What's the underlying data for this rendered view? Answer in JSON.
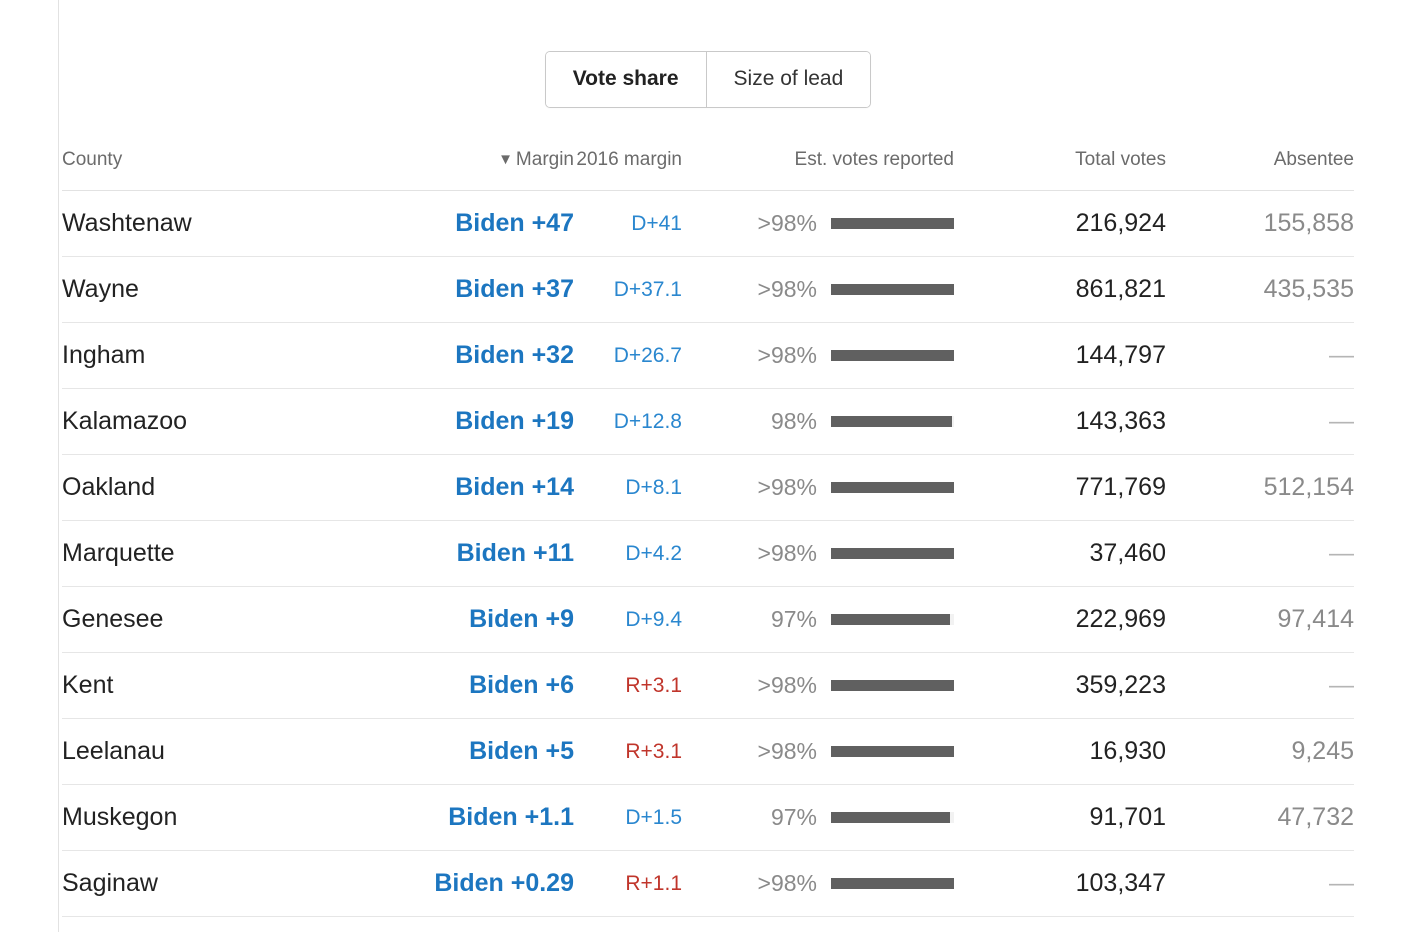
{
  "toggle": {
    "options": [
      {
        "label": "Vote share",
        "active": true
      },
      {
        "label": "Size of lead",
        "active": false
      }
    ]
  },
  "table": {
    "columns": {
      "county": "County",
      "margin": "Margin",
      "margin_sort_icon": "▼",
      "margin_2016": "2016 margin",
      "reported": "Est. votes reported",
      "total_votes": "Total votes",
      "absentee": "Absentee"
    },
    "sort": {
      "column": "Margin",
      "direction": "desc"
    },
    "empty_value": "—",
    "rows": [
      {
        "county": "Washtenaw",
        "margin": "Biden +47",
        "margin_2016": "D+41",
        "margin_2016_party": "dem",
        "reported": ">98%",
        "reported_pct": 100,
        "total_votes": "216,924",
        "absentee": "155,858"
      },
      {
        "county": "Wayne",
        "margin": "Biden +37",
        "margin_2016": "D+37.1",
        "margin_2016_party": "dem",
        "reported": ">98%",
        "reported_pct": 100,
        "total_votes": "861,821",
        "absentee": "435,535"
      },
      {
        "county": "Ingham",
        "margin": "Biden +32",
        "margin_2016": "D+26.7",
        "margin_2016_party": "dem",
        "reported": ">98%",
        "reported_pct": 100,
        "total_votes": "144,797",
        "absentee": "—"
      },
      {
        "county": "Kalamazoo",
        "margin": "Biden +19",
        "margin_2016": "D+12.8",
        "margin_2016_party": "dem",
        "reported": "98%",
        "reported_pct": 98,
        "total_votes": "143,363",
        "absentee": "—"
      },
      {
        "county": "Oakland",
        "margin": "Biden +14",
        "margin_2016": "D+8.1",
        "margin_2016_party": "dem",
        "reported": ">98%",
        "reported_pct": 100,
        "total_votes": "771,769",
        "absentee": "512,154"
      },
      {
        "county": "Marquette",
        "margin": "Biden +11",
        "margin_2016": "D+4.2",
        "margin_2016_party": "dem",
        "reported": ">98%",
        "reported_pct": 100,
        "total_votes": "37,460",
        "absentee": "—"
      },
      {
        "county": "Genesee",
        "margin": "Biden +9",
        "margin_2016": "D+9.4",
        "margin_2016_party": "dem",
        "reported": "97%",
        "reported_pct": 97,
        "total_votes": "222,969",
        "absentee": "97,414"
      },
      {
        "county": "Kent",
        "margin": "Biden +6",
        "margin_2016": "R+3.1",
        "margin_2016_party": "rep",
        "reported": ">98%",
        "reported_pct": 100,
        "total_votes": "359,223",
        "absentee": "—"
      },
      {
        "county": "Leelanau",
        "margin": "Biden +5",
        "margin_2016": "R+3.1",
        "margin_2016_party": "rep",
        "reported": ">98%",
        "reported_pct": 100,
        "total_votes": "16,930",
        "absentee": "9,245"
      },
      {
        "county": "Muskegon",
        "margin": "Biden +1.1",
        "margin_2016": "D+1.5",
        "margin_2016_party": "dem",
        "reported": "97%",
        "reported_pct": 97,
        "total_votes": "91,701",
        "absentee": "47,732"
      },
      {
        "county": "Saginaw",
        "margin": "Biden +0.29",
        "margin_2016": "R+1.1",
        "margin_2016_party": "rep",
        "reported": ">98%",
        "reported_pct": 100,
        "total_votes": "103,347",
        "absentee": "—"
      }
    ]
  },
  "colors": {
    "democrat": "#1c76c0",
    "democrat_light": "#2a87cf",
    "republican": "#c0352b",
    "bar_fill": "#606060",
    "bar_track": "#f2f2f2",
    "rule": "#e2e2e2"
  }
}
